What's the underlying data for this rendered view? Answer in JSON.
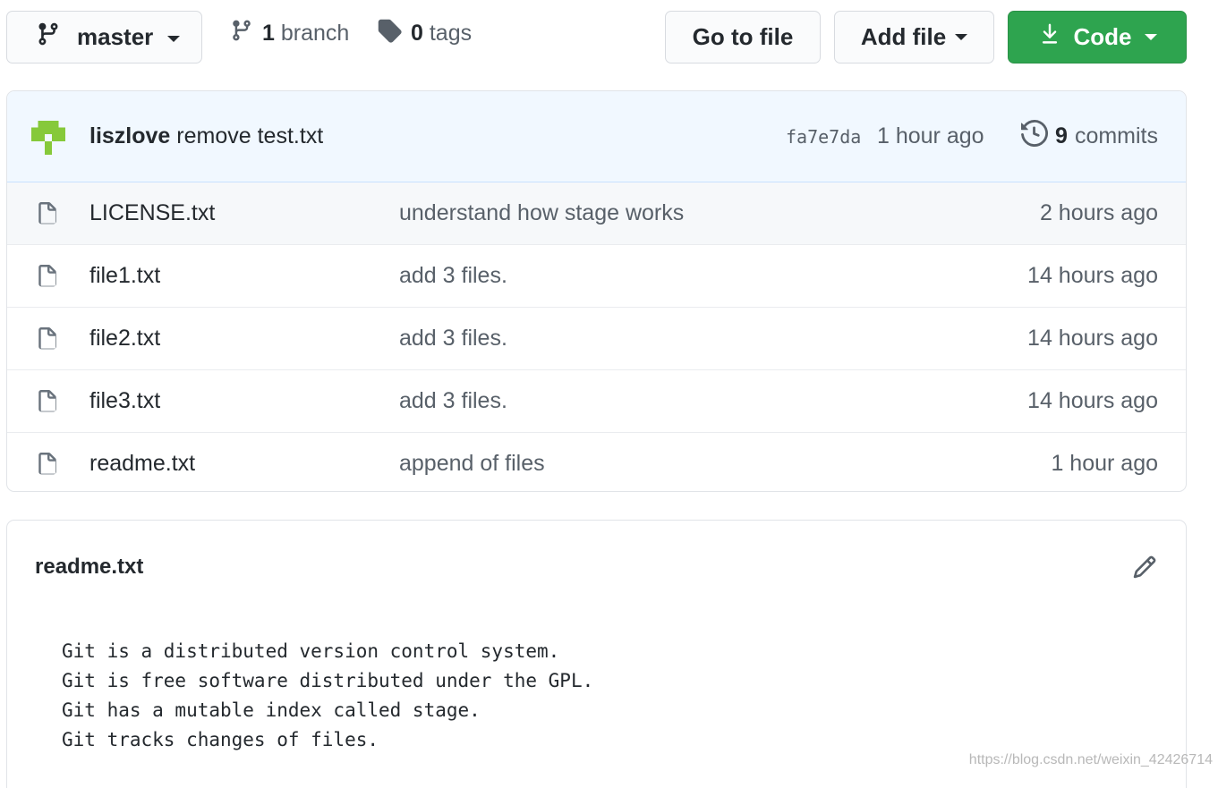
{
  "branch_select": {
    "label": "master",
    "icon": "git-branch-icon"
  },
  "branches": {
    "count": "1",
    "label": "branch"
  },
  "tags": {
    "count": "0",
    "label": "tags"
  },
  "toolbar": {
    "go_to_file": "Go to file",
    "add_file": "Add file",
    "code": "Code",
    "code_color": "#2ea44f"
  },
  "latest_commit": {
    "author": "liszlove",
    "message": "remove test.txt",
    "sha": "fa7e7da",
    "time": "1 hour ago",
    "commits_count": "9",
    "commits_label": "commits"
  },
  "files": [
    {
      "name": "LICENSE.txt",
      "message": "understand how stage works",
      "time": "2 hours ago"
    },
    {
      "name": "file1.txt",
      "message": "add 3 files.",
      "time": "14 hours ago"
    },
    {
      "name": "file2.txt",
      "message": "add 3 files.",
      "time": "14 hours ago"
    },
    {
      "name": "file3.txt",
      "message": "add 3 files.",
      "time": "14 hours ago"
    },
    {
      "name": "readme.txt",
      "message": "append of files",
      "time": "1 hour ago"
    }
  ],
  "readme": {
    "title": "readme.txt",
    "content": "Git is a distributed version control system.\nGit is free software distributed under the GPL.\nGit has a mutable index called stage.\nGit tracks changes of files."
  },
  "watermark": "https://blog.csdn.net/weixin_42426714"
}
